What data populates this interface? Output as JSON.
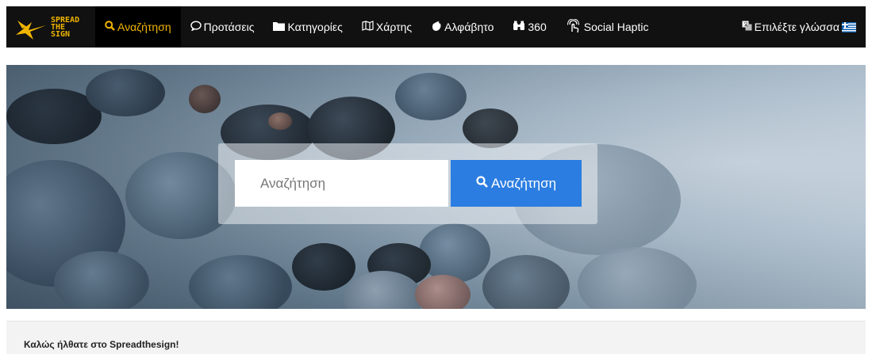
{
  "logo": {
    "lines": [
      "SPREAD",
      "THE",
      "SIGN"
    ],
    "color": "#f0b400"
  },
  "nav": {
    "items": [
      {
        "label": "Αναζήτηση",
        "icon": "search-icon",
        "glyph": "🔍",
        "active": true
      },
      {
        "label": "Προτάσεις",
        "icon": "speech-bubble-icon",
        "glyph": "💬",
        "active": false
      },
      {
        "label": "Κατηγορίες",
        "icon": "folder-icon",
        "glyph": "📁",
        "active": false
      },
      {
        "label": "Χάρτης",
        "icon": "map-icon",
        "glyph": "🗺",
        "active": false
      },
      {
        "label": "Αλφάβητο",
        "icon": "hand-icon",
        "glyph": "✋",
        "active": false
      },
      {
        "label": "360",
        "icon": "binoculars-icon",
        "glyph": "⛓",
        "active": false
      },
      {
        "label": "Social Haptic",
        "icon": "haptic-hand-icon",
        "glyph": "☝",
        "active": false
      }
    ],
    "language": {
      "label": "Επιλέξτε γλώσσα",
      "icon": "translate-icon",
      "flag": "greek-flag-icon"
    }
  },
  "search": {
    "placeholder": "Αναζήτηση",
    "button_label": "Αναζήτηση",
    "button_color": "#2b7de1"
  },
  "welcome": {
    "text": "Καλώς ήλθατε στο Spreadthesign!"
  },
  "colors": {
    "navbar": "#111111",
    "accent": "#f0b400"
  }
}
